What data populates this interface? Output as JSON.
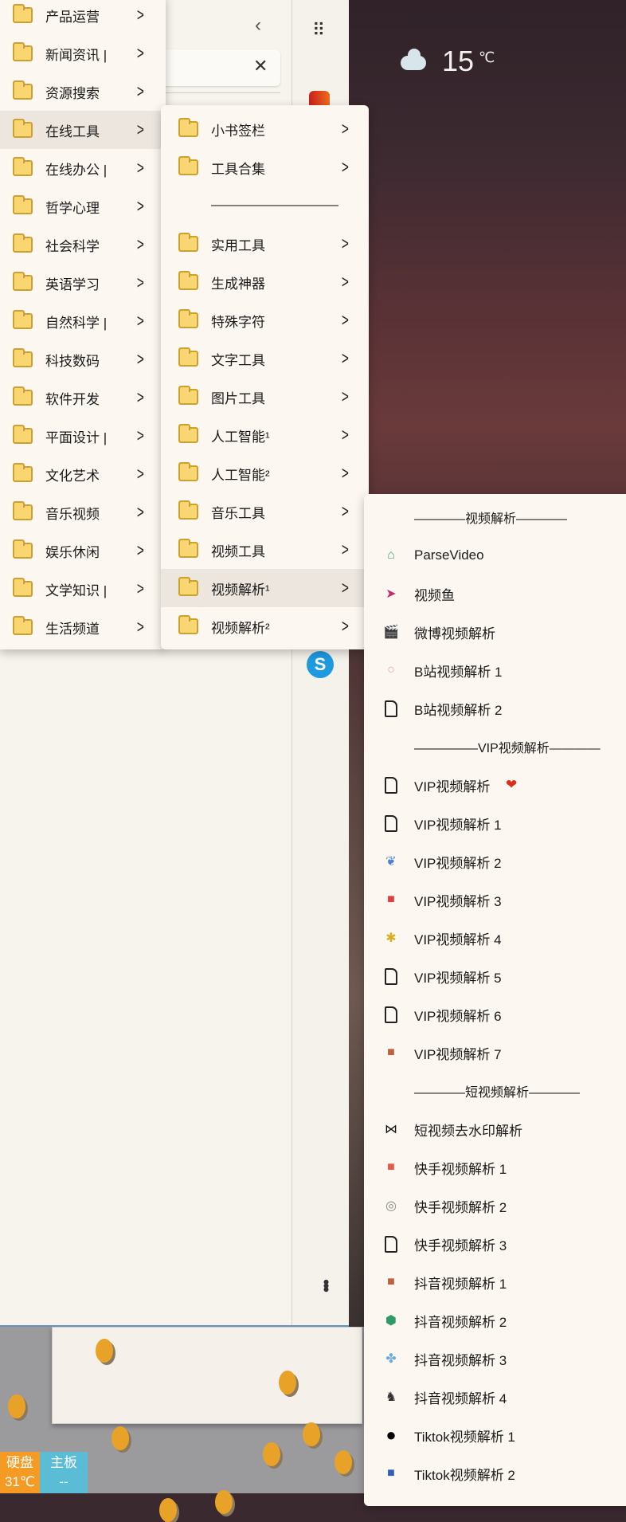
{
  "weather": {
    "temp": "15",
    "unit": "℃",
    "icon": "cloud-icon"
  },
  "menu1": {
    "items": [
      "产品运营",
      "新闻资讯 |",
      "资源搜索",
      "在线工具",
      "在线办公 |",
      "哲学心理",
      "社会科学",
      "英语学习",
      "自然科学 |",
      "科技数码",
      "软件开发",
      "平面设计 |",
      "文化艺术",
      "音乐视频",
      "娱乐休闲",
      "文学知识 |",
      "生活频道"
    ],
    "highlighted": 3
  },
  "menu2": {
    "items": [
      "小书签栏",
      "工具合集",
      "——————————",
      "实用工具",
      "生成神器",
      "特殊字符",
      "文字工具",
      "图片工具",
      "人工智能¹",
      "人工智能²",
      "音乐工具",
      "视频工具",
      "视频解析¹",
      "视频解析²"
    ],
    "separator_index": 2,
    "highlighted": 12
  },
  "menu3": {
    "items": [
      {
        "label": "————视频解析————",
        "type": "header"
      },
      {
        "label": "ParseVideo",
        "icon": "cloud-video-icon",
        "color": "#3aa872"
      },
      {
        "label": "视频鱼",
        "icon": "play-arrow-icon",
        "color": "#c0306a"
      },
      {
        "label": "微博视频解析",
        "icon": "clapperboard-icon",
        "color": "#222222"
      },
      {
        "label": "B站视频解析 1",
        "icon": "wreath-icon",
        "color": "#d9a9a0"
      },
      {
        "label": "B站视频解析 2",
        "icon": "document-icon"
      },
      {
        "label": "—————VIP视频解析————",
        "type": "header"
      },
      {
        "label": "VIP视频解析",
        "icon": "document-icon",
        "extra": "❤"
      },
      {
        "label": "VIP视频解析 1",
        "icon": "document-icon"
      },
      {
        "label": "VIP视频解析 2",
        "icon": "feather-icon",
        "color": "#4a86d0"
      },
      {
        "label": "VIP视频解析 3",
        "icon": "toolbox-icon",
        "color": "#e04040"
      },
      {
        "label": "VIP视频解析 4",
        "icon": "mascot-icon",
        "color": "#d8b020"
      },
      {
        "label": "VIP视频解析 5",
        "icon": "document-icon"
      },
      {
        "label": "VIP视频解析 6",
        "icon": "document-icon"
      },
      {
        "label": "VIP视频解析 7",
        "icon": "avatar-icon",
        "color": "#c06040"
      },
      {
        "label": "————短视频解析————",
        "type": "header"
      },
      {
        "label": "短视频去水印解析",
        "icon": "bowtie-icon",
        "color": "#111111"
      },
      {
        "label": "快手视频解析 1",
        "icon": "red-badge-icon",
        "color": "#e85a4a"
      },
      {
        "label": "快手视频解析 2",
        "icon": "circle-logo-icon",
        "color": "#888888"
      },
      {
        "label": "快手视频解析 3",
        "icon": "document-icon"
      },
      {
        "label": "抖音视频解析 1",
        "icon": "avatar-icon",
        "color": "#c06040"
      },
      {
        "label": "抖音视频解析 2",
        "icon": "hexagon-link-icon",
        "color": "#2e9a6a"
      },
      {
        "label": "抖音视频解析 3",
        "icon": "clover-icon",
        "color": "#6aa8e0"
      },
      {
        "label": "抖音视频解析 4",
        "icon": "rabbit-icon",
        "color": "#333333"
      },
      {
        "label": "Tiktok视频解析 1",
        "icon": "tiktok-t-icon",
        "color": "#000000"
      },
      {
        "label": "Tiktok视频解析 2",
        "icon": "blue-square-icon",
        "color": "#3060c0"
      }
    ]
  },
  "taskbar": {
    "disk_label": "硬盘",
    "disk_value": "31℃",
    "board_label": "主板",
    "board_value": "--",
    "disk_color": "#f59a23",
    "board_color": "#5bbcd6"
  }
}
